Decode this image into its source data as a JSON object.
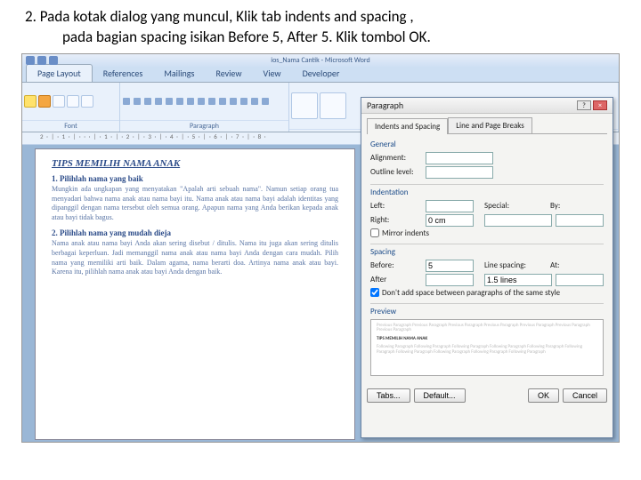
{
  "instruction": {
    "num": "2.",
    "line1": "Pada kotak dialog yang muncul, Klik tab indents and spacing ,",
    "line2": "pada bagian spacing isikan Before 5, After 5. Klik tombol OK."
  },
  "word": {
    "title": "ios_Nama Cantik - Microsoft Word",
    "tabs": [
      "Page Layout",
      "References",
      "Mailings",
      "Review",
      "View",
      "Developer"
    ],
    "groups": {
      "font": "Font",
      "paragraph": "Paragraph"
    },
    "ruler": "2 · | · 1 · | · · · | · 1 · | · 2 · | · 3 · | · 4 · | · 5 · | · 6 · | · 7 · | · 8 ·"
  },
  "doc": {
    "title": "TIPS MEMILIH NAMA ANAK",
    "h1_num": "1.",
    "h1": "Pilihlah nama yang baik",
    "p1": "Mungkin ada ungkapan yang menyatakan \"Apalah arti sebuah nama\". Namun setiap orang tua menyadari bahwa nama anak atau nama bayi itu. Nama anak atau nama bayi adalah identitas yang dipanggil dengan nama tersebut oleh semua orang. Apapun nama yang Anda berikan kepada anak atau bayi tidak bagus.",
    "h2_num": "2.",
    "h2": "Pilihlah nama yang mudah dieja",
    "p2": "Nama anak atau nama bayi Anda akan sering disebut / ditulis. Nama itu juga akan sering ditulis berbagai keperluan. Jadi memanggil nama anak atau nama bayi Anda dengan cara mudah. Pilih nama yang memiliki arti baik. Dalam agama, nama berarti doa. Artinya nama anak atau bayi. Karena itu, pilihlah nama anak atau bayi Anda dengan baik."
  },
  "dialog": {
    "title": "Paragraph",
    "tabs": {
      "t1": "Indents and Spacing",
      "t2": "Line and Page Breaks"
    },
    "general": {
      "label": "General",
      "alignment": "Alignment:",
      "alignment_val": "",
      "outline": "Outline level:",
      "outline_val": ""
    },
    "indent": {
      "label": "Indentation",
      "left": "Left:",
      "left_val": "",
      "right": "Right:",
      "right_val": "0 cm",
      "special": "Special:",
      "special_val": "",
      "by": "By:",
      "by_val": "",
      "mirror": "Mirror indents"
    },
    "spacing": {
      "label": "Spacing",
      "before": "Before:",
      "before_val": "5",
      "after": "After",
      "after_val": "",
      "linespacing": "Line spacing:",
      "linespacing_val": "1.5 lines",
      "at": "At:",
      "at_val": "",
      "noadd": "Don't add space between paragraphs of the same style"
    },
    "preview": {
      "label": "Preview",
      "faint": "Previous Paragraph Previous Paragraph Previous Paragraph Previous Paragraph Previous Paragraph Previous Paragraph Previous Paragraph",
      "strong": "TIPS MEMILIH NAMA ANAK",
      "following": "Following Paragraph Following Paragraph Following Paragraph Following Paragraph Following Paragraph Following Paragraph Following Paragraph Following Paragraph Following Paragraph Following Paragraph"
    },
    "buttons": {
      "tabs": "Tabs...",
      "default": "Default...",
      "ok": "OK",
      "cancel": "Cancel"
    }
  }
}
